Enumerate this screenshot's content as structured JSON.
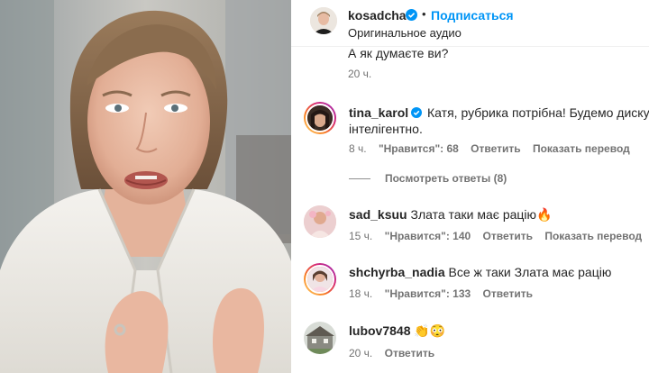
{
  "post": {
    "username": "kosadcha",
    "follow_label": "Подписаться",
    "separator": "•",
    "audio": "Оригинальное аудио"
  },
  "previous_comment": {
    "text_partial": "А як думаєте ви?",
    "time": "20 ч."
  },
  "comments": [
    {
      "username": "tina_karol",
      "verified": true,
      "text_line1": "Катя, рубрика потрібна! Будемо дискутувати",
      "text_line2": "інтелігентно.",
      "time": "8 ч.",
      "likes": "\"Нравится\": 68",
      "reply": "Ответить",
      "translate": "Показать перевод"
    },
    {
      "username": "sad_ksuu",
      "verified": false,
      "text_line1": "Злата таки має рацію🔥",
      "time": "15 ч.",
      "likes": "\"Нравится\": 140",
      "reply": "Ответить",
      "translate": "Показать перевод"
    },
    {
      "username": "shchyrba_nadia",
      "verified": false,
      "text_line1": "Все ж таки Злата має рацію",
      "time": "18 ч.",
      "likes": "\"Нравится\": 133",
      "reply": "Ответить"
    },
    {
      "username": "lubov7848",
      "verified": false,
      "text_line1": "👏😳",
      "time": "20 ч.",
      "reply": "Ответить"
    }
  ],
  "view_replies_label": "Посмотреть ответы (8)",
  "colors": {
    "link_blue": "#0095f6",
    "text_primary": "#262626",
    "text_secondary": "#737373",
    "verified_blue": "#0095f6"
  }
}
